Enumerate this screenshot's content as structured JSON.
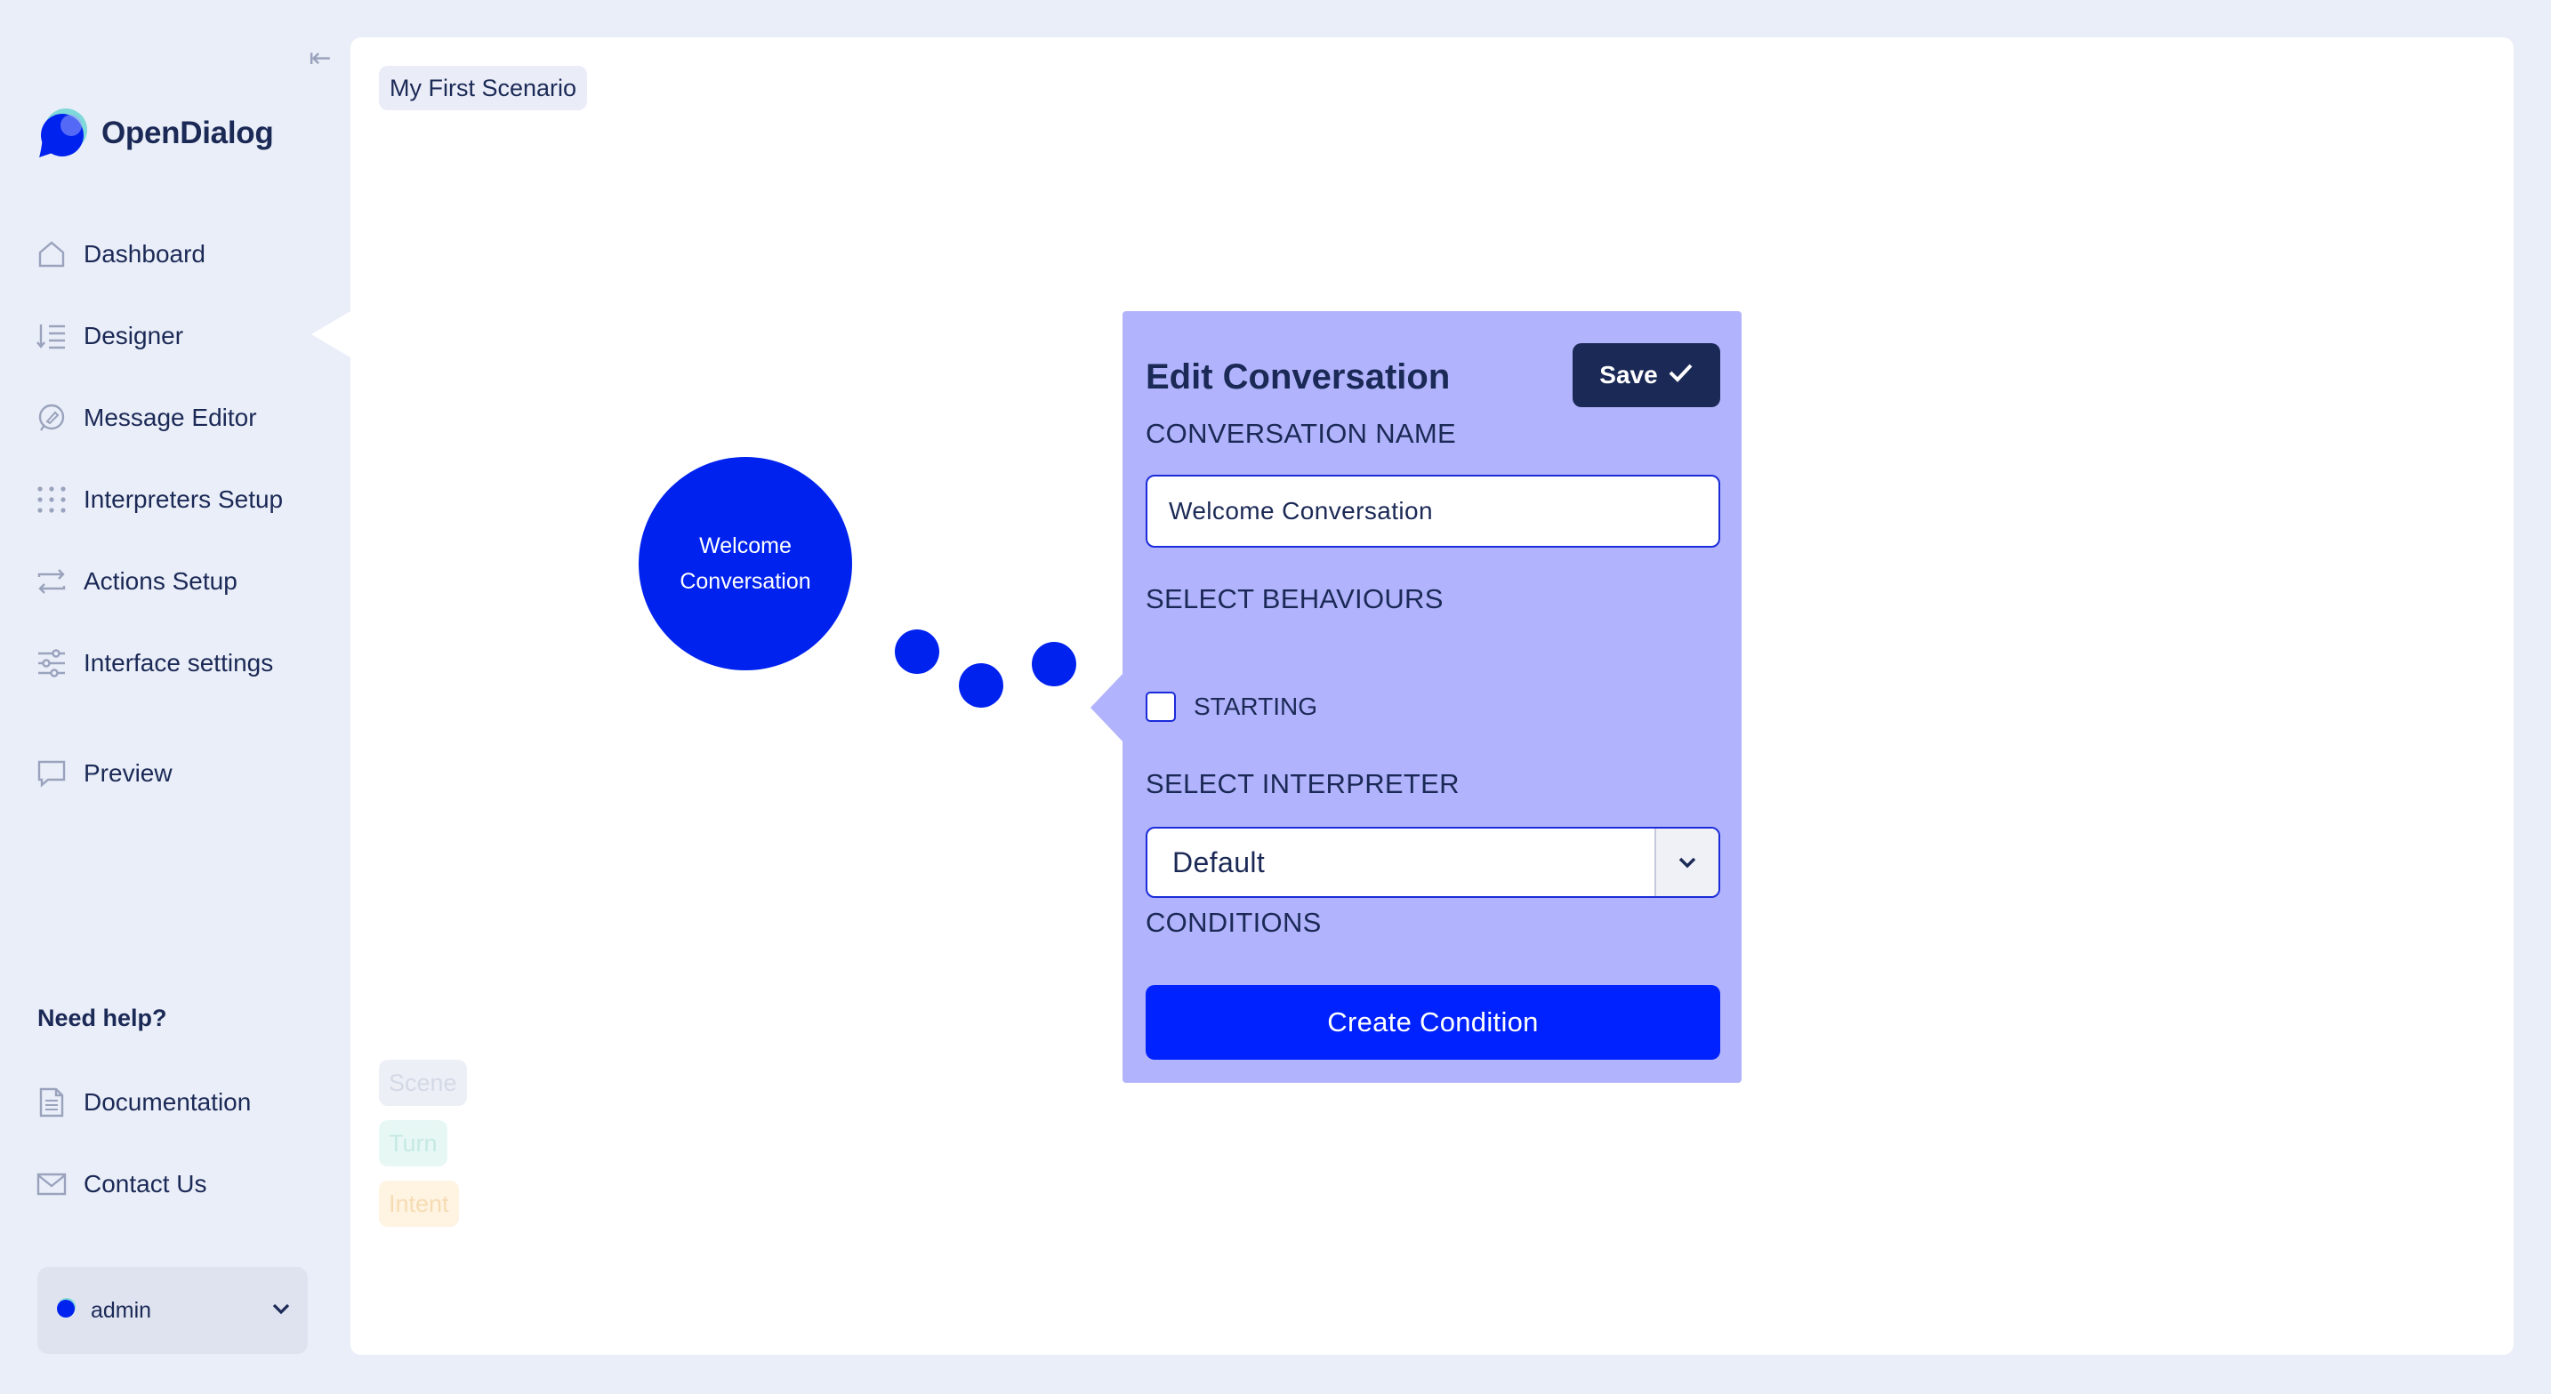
{
  "app": {
    "name": "OpenDialog"
  },
  "sidebar": {
    "collapse_icon": "collapse-left-icon",
    "items": [
      {
        "label": "Dashboard",
        "icon": "home-icon"
      },
      {
        "label": "Designer",
        "icon": "designer-list-icon",
        "active": true
      },
      {
        "label": "Message Editor",
        "icon": "message-edit-icon"
      },
      {
        "label": "Interpreters Setup",
        "icon": "grid-dots-icon"
      },
      {
        "label": "Actions Setup",
        "icon": "swap-arrows-icon"
      },
      {
        "label": "Interface settings",
        "icon": "sliders-icon"
      },
      {
        "label": "Preview",
        "icon": "chat-preview-icon"
      }
    ],
    "help": {
      "title": "Need help?",
      "items": [
        {
          "label": "Documentation",
          "icon": "document-icon"
        },
        {
          "label": "Contact Us",
          "icon": "mail-icon"
        }
      ]
    },
    "user": {
      "name": "admin"
    }
  },
  "main": {
    "breadcrumb": "My First Scenario",
    "node": {
      "label": "Welcome Conversation"
    },
    "legend": [
      {
        "label": "Scene",
        "color": "#eceff5",
        "text_color": "#d4d9e6"
      },
      {
        "label": "Turn",
        "color": "#e6f7f4",
        "text_color": "#c6e9e2"
      },
      {
        "label": "Intent",
        "color": "#fff3e1",
        "text_color": "#f6dcb4"
      }
    ]
  },
  "panel": {
    "title": "Edit Conversation",
    "save_label": "Save",
    "name_label": "CONVERSATION NAME",
    "name_value": "Welcome Conversation",
    "behaviours_label": "SELECT BEHAVIOURS",
    "starting_label": "STARTING",
    "starting_checked": false,
    "interpreter_label": "SELECT INTERPRETER",
    "interpreter_value": "Default",
    "conditions_label": "CONDITIONS",
    "create_condition_label": "Create Condition"
  },
  "colors": {
    "accent": "#0022ee",
    "panel_bg": "#b1b3fc",
    "navy": "#1b2956",
    "page_bg": "#eaeef8"
  }
}
